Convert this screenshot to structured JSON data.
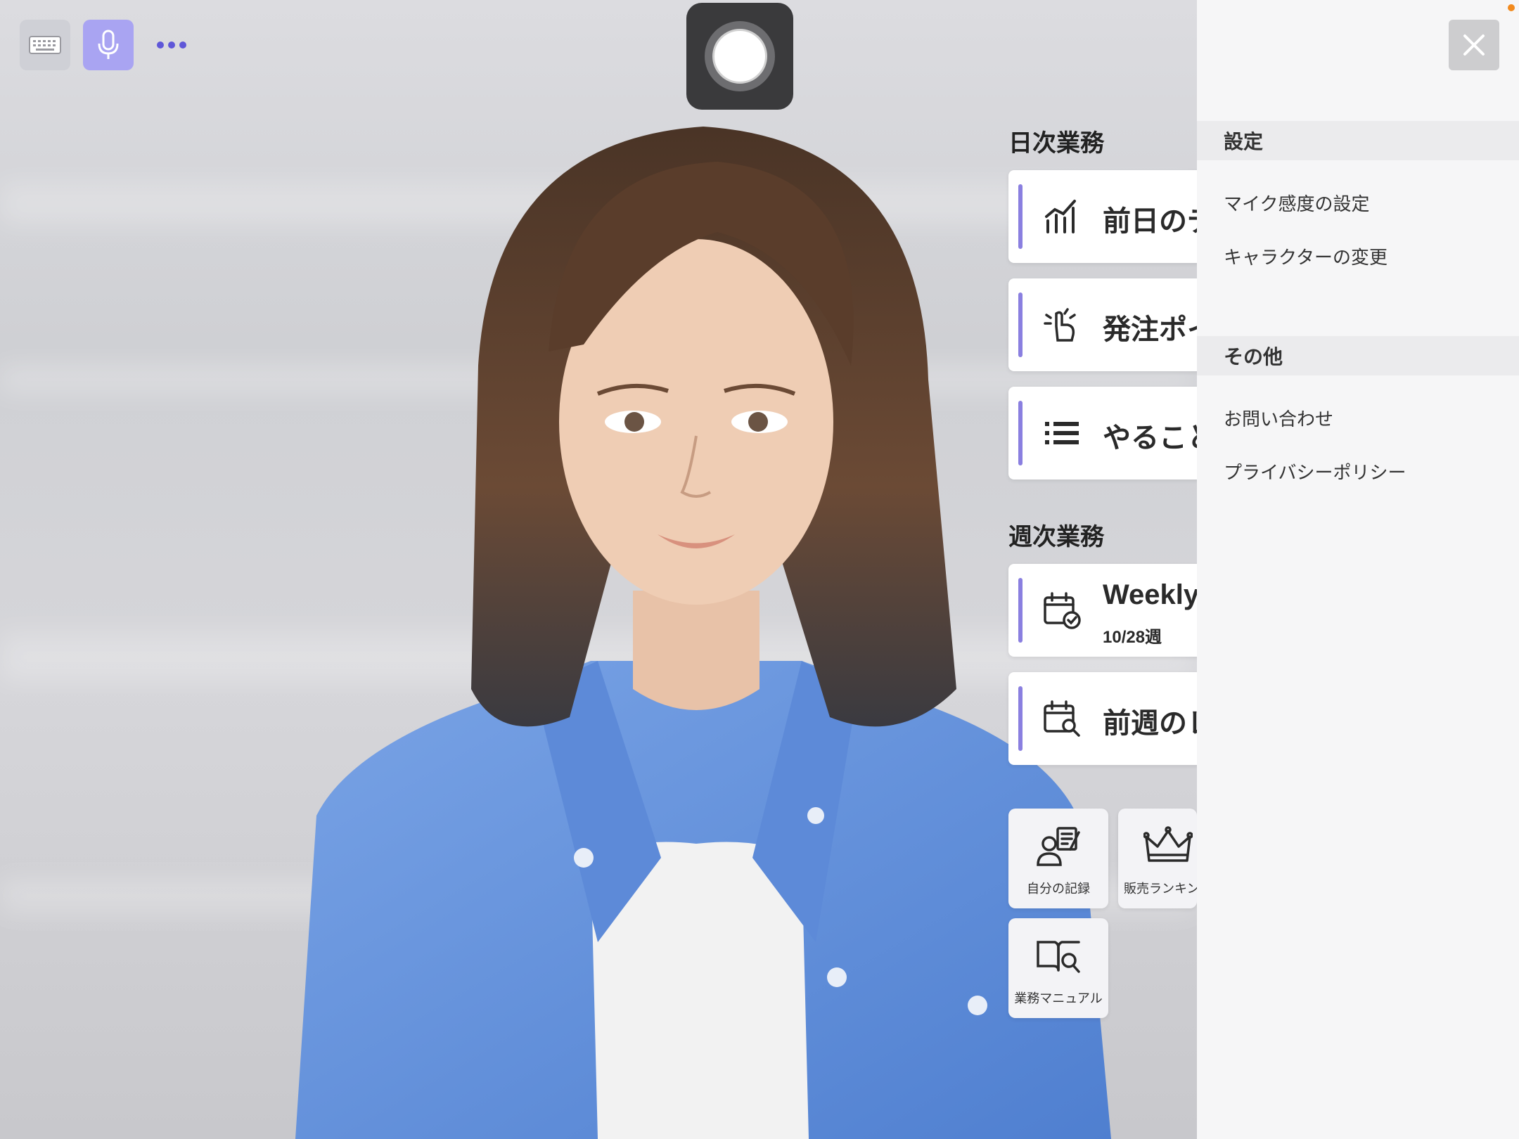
{
  "toolbar": {
    "keyboard_icon": "keyboard-icon",
    "mic_icon": "microphone-icon",
    "more_icon": "more-dots-icon"
  },
  "record": {
    "icon": "record-icon"
  },
  "daily": {
    "title": "日次業務",
    "items": [
      {
        "label": "前日のデ",
        "icon": "bar-chart-icon"
      },
      {
        "label": "発注ポイ",
        "icon": "pointing-hand-icon"
      },
      {
        "label": "やること",
        "icon": "list-icon"
      }
    ]
  },
  "weekly": {
    "title": "週次業務",
    "items": [
      {
        "label": "Weekly",
        "sub": "10/28週",
        "icon": "calendar-check-icon"
      },
      {
        "label": "前週のレ",
        "icon": "calendar-search-icon"
      }
    ]
  },
  "tiles": [
    {
      "label": "自分の記録",
      "icon": "person-record-icon"
    },
    {
      "label": "販売ランキン",
      "icon": "crown-icon"
    },
    {
      "label": "業務マニュアル",
      "icon": "book-search-icon"
    }
  ],
  "panel": {
    "settings_title": "設定",
    "settings_items": [
      "マイク感度の設定",
      "キャラクターの変更"
    ],
    "other_title": "その他",
    "other_items": [
      "お問い合わせ",
      "プライバシーポリシー"
    ],
    "close_icon": "close-icon"
  },
  "colors": {
    "accent": "#8a7fe0",
    "mic_bg": "#a9a4f2",
    "panel_bg": "#f6f6f7",
    "record_bg": "#3a3a3c"
  }
}
